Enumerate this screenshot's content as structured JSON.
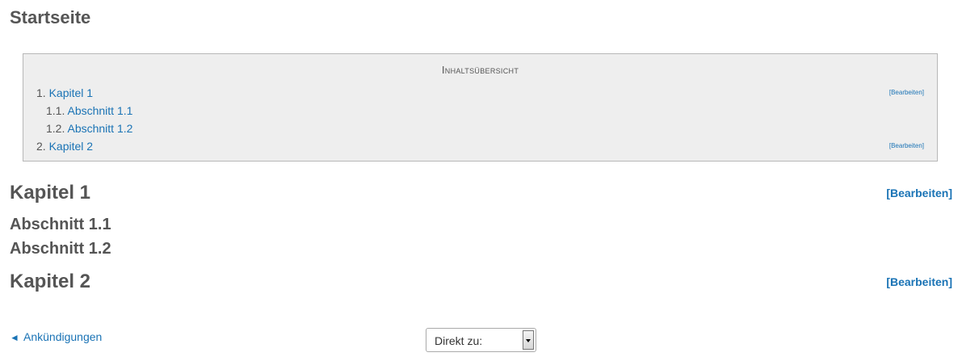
{
  "page": {
    "title": "Startseite"
  },
  "toc": {
    "title": "Inhaltsübersicht",
    "edit_label": "[Bearbeiten]",
    "items": [
      {
        "number": "1.",
        "label": "Kapitel 1",
        "editable": true
      },
      {
        "number": "1.1.",
        "label": "Abschnitt 1.1",
        "editable": false
      },
      {
        "number": "1.2.",
        "label": "Abschnitt 1.2",
        "editable": false
      },
      {
        "number": "2.",
        "label": "Kapitel 2",
        "editable": true
      }
    ]
  },
  "content": {
    "edit_label": "[Bearbeiten]",
    "chapter1": "Kapitel 1",
    "section11": "Abschnitt 1.1",
    "section12": "Abschnitt 1.2",
    "chapter2": "Kapitel 2"
  },
  "footer": {
    "prev_arrow": "◄",
    "prev_label": "Ankündigungen",
    "jump_select": "Direkt zu:"
  }
}
